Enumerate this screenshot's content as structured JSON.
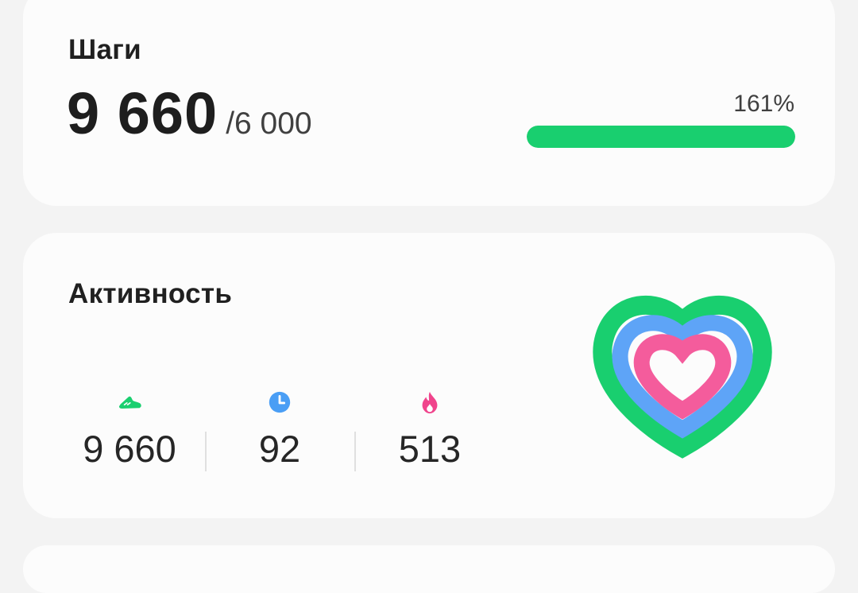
{
  "steps_card": {
    "title": "Шаги",
    "count": "9 660",
    "goal": "/6 000",
    "percent_label": "161%",
    "progress_fraction": 1.0,
    "accent_color": "#19cf6f"
  },
  "activity_card": {
    "title": "Активность",
    "stats": [
      {
        "icon": "shoe-icon",
        "value": "9 660",
        "color": "#19cf6f"
      },
      {
        "icon": "clock-icon",
        "value": "92",
        "color": "#4a9ef5"
      },
      {
        "icon": "flame-icon",
        "value": "513",
        "color": "#f0448c"
      }
    ],
    "rings": {
      "outer_color": "#19cf6f",
      "middle_color": "#5ea4f7",
      "inner_color": "#f45c9c"
    }
  }
}
